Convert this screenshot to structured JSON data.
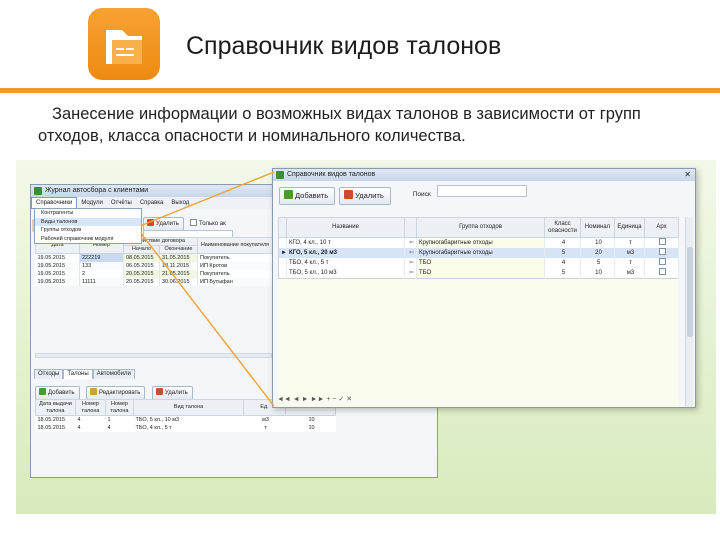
{
  "slide": {
    "title": "Справочник видов талонов",
    "description": "Занесение информации о возможных видах талонов в зависимости от групп отходов, класса опасности и номинального количества."
  },
  "colors": {
    "accent": "#f39a26",
    "panel": "#e4f1d2",
    "selection": "#c9daf0"
  },
  "main_window": {
    "title": "Журнал автосбора с клиентами",
    "menu": [
      "Справочники",
      "Модули",
      "Отчёты",
      "Справка",
      "Выход"
    ],
    "menu_dropdown": [
      "Контрагенты",
      "Виды талонов",
      "Группы отходов",
      "Рабочий справочник модуля"
    ],
    "toolbar": {
      "delete_label": "Удалить",
      "only_active_label": "Только ак"
    },
    "grid": {
      "headers": [
        "Дата",
        "Номер",
        "Начало",
        "Окончание",
        "Наименование покупателя"
      ],
      "group_header": "Действие договора",
      "rows": [
        [
          "19.05.2015",
          "222219",
          "08.05.2015",
          "31.05.2015",
          "Покупатель"
        ],
        [
          "19.05.2015",
          "133",
          "06.05.2015",
          "18.11.2015",
          "ИП Кротов"
        ],
        [
          "19.05.2015",
          "2",
          "20.05.2015",
          "21.05.2015",
          "Покупатель"
        ],
        [
          "19.05.2015",
          "11111",
          "20.05.2015",
          "30.06.2015",
          "ИП Бутыфан"
        ]
      ]
    },
    "tabs": [
      "Отходы",
      "Талоны",
      "Автомобили"
    ],
    "tab_toolbar": {
      "add": "Добавить",
      "edit": "Редактировать",
      "delete": "Удалить"
    },
    "grid2": {
      "headers": [
        "Дата выдачи талона",
        "Номер талона",
        "Номер талона",
        "Вид талона",
        "Ед."
      ],
      "rows": [
        [
          "18.05.2015",
          "4",
          "1",
          "ТБО, 5 кл., 10 м3",
          "м3",
          "10"
        ],
        [
          "18.05.2015",
          "4",
          "4",
          "ТБО, 4 кл., 5 т",
          "т",
          "10"
        ]
      ]
    }
  },
  "popup_window": {
    "title": "Справочник видов талонов",
    "toolbar": {
      "add": "Добавить",
      "delete": "Удалить",
      "search_label": "Поиск"
    },
    "headers": [
      "Название",
      "Группа отходов",
      "Класс опасности",
      "Номинал",
      "Единица",
      "Арх"
    ],
    "rows": [
      {
        "name": "КГО, 4 кл., 10 т",
        "group": "Крупногабаритные отходы",
        "class": "4",
        "nominal": "10",
        "unit": "т",
        "archived": false
      },
      {
        "name": "КГО, 5 кл., 20 м3",
        "group": "Крупногабаритные отходы",
        "class": "5",
        "nominal": "20",
        "unit": "м3",
        "archived": false
      },
      {
        "name": "ТБО, 4 кл., 5 т",
        "group": "ТБО",
        "class": "4",
        "nominal": "5",
        "unit": "т",
        "archived": false
      },
      {
        "name": "ТБО, 5 кл., 10 м3",
        "group": "ТБО",
        "class": "5",
        "nominal": "10",
        "unit": "м3",
        "archived": false
      }
    ]
  }
}
